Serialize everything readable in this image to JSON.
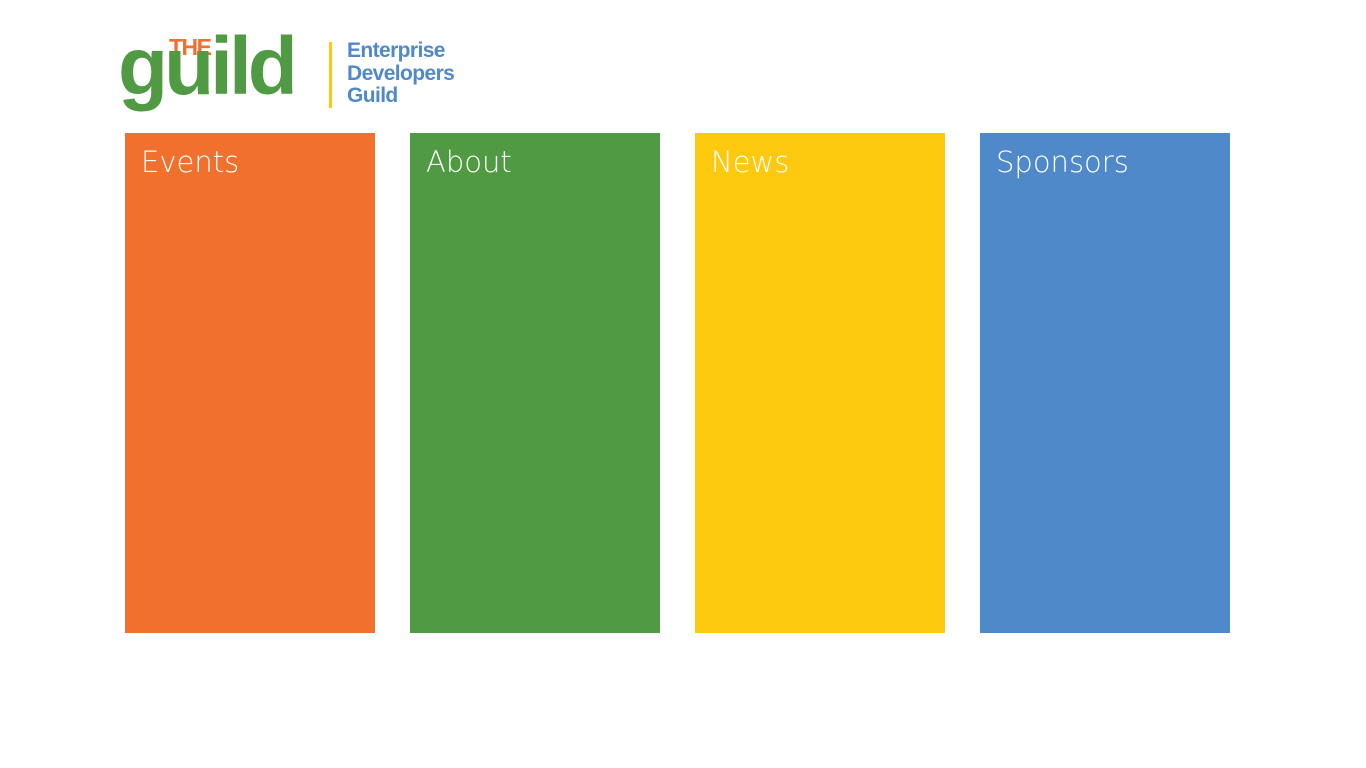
{
  "logo": {
    "the": "THE",
    "guild": "guild",
    "tagline": [
      "Enterprise",
      "Developers",
      "Guild"
    ]
  },
  "colors": {
    "orange": "#F2702E",
    "green": "#4F9A43",
    "yellow": "#FDC90F",
    "blue": "#4F89C9",
    "divider": "#FDC90F"
  },
  "tiles": [
    {
      "label": "Events",
      "color": "#F2702E"
    },
    {
      "label": "About",
      "color": "#4F9A43"
    },
    {
      "label": "News",
      "color": "#FDC90F"
    },
    {
      "label": "Sponsors",
      "color": "#4F89C9"
    }
  ]
}
